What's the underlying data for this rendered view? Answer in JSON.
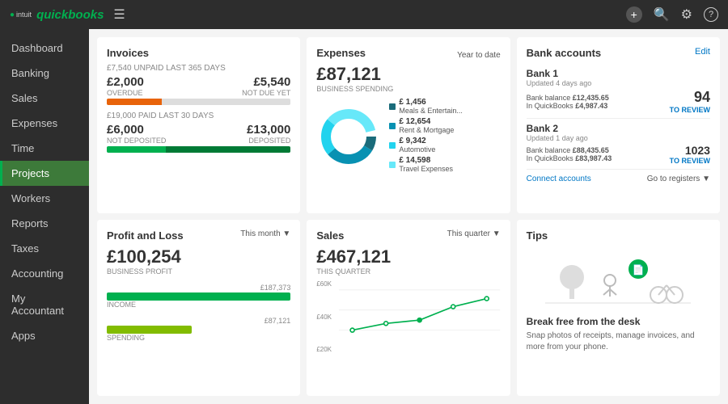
{
  "topnav": {
    "logo_text": "quickbooks",
    "intuit_text": "intuit",
    "add_label": "+",
    "search_label": "🔍",
    "settings_label": "⚙",
    "help_label": "?"
  },
  "sidebar": {
    "items": [
      {
        "label": "Dashboard",
        "active": false
      },
      {
        "label": "Banking",
        "active": false
      },
      {
        "label": "Sales",
        "active": false
      },
      {
        "label": "Expenses",
        "active": false
      },
      {
        "label": "Time",
        "active": false
      },
      {
        "label": "Projects",
        "active": true
      },
      {
        "label": "Workers",
        "active": false
      },
      {
        "label": "Reports",
        "active": false
      },
      {
        "label": "Taxes",
        "active": false
      },
      {
        "label": "Accounting",
        "active": false
      },
      {
        "label": "My Accountant",
        "active": false
      },
      {
        "label": "Apps",
        "active": false
      }
    ]
  },
  "invoices": {
    "title": "Invoices",
    "unpaid_label": "£7,540 UNPAID LAST 365 DAYS",
    "overdue_amount": "£2,000",
    "overdue_label": "OVERDUE",
    "not_due_amount": "£5,540",
    "not_due_label": "NOT DUE YET",
    "paid_label": "£19,000 PAID LAST 30 DAYS",
    "not_deposited_amount": "£6,000",
    "not_deposited_label": "NOT DEPOSITED",
    "deposited_amount": "£13,000",
    "deposited_label": "DEPOSITED"
  },
  "expenses": {
    "title": "Expenses",
    "period": "Year to date",
    "amount": "£87,121",
    "label": "BUSINESS SPENDING",
    "legend": [
      {
        "label": "Meals & Entertain...",
        "value": "£ 1,456",
        "color": "#1a6b7a",
        "pct": 8
      },
      {
        "label": "Rent & Mortgage",
        "value": "£ 12,654",
        "color": "#0891b2",
        "pct": 30
      },
      {
        "label": "Automotive",
        "value": "£ 9,342",
        "color": "#22d3ee",
        "pct": 22
      },
      {
        "label": "Travel Expenses",
        "value": "£ 14,598",
        "color": "#67e8f9",
        "pct": 35
      }
    ]
  },
  "bank_accounts": {
    "title": "Bank accounts",
    "edit_label": "Edit",
    "bank1": {
      "name": "Bank 1",
      "updated": "Updated 4 days ago",
      "balance_label": "Bank balance",
      "balance_val": "£12,435.65",
      "qb_label": "In QuickBooks",
      "qb_val": "£4,987.43",
      "review_num": "94",
      "review_label": "TO REVIEW"
    },
    "bank2": {
      "name": "Bank 2",
      "updated": "Updated 1 day ago",
      "balance_label": "Bank balance",
      "balance_val": "£88,435.65",
      "qb_label": "In QuickBooks",
      "qb_val": "£83,987.43",
      "review_num": "1023",
      "review_label": "TO REVIEW"
    },
    "connect_label": "Connect accounts",
    "registers_label": "Go to registers ▼"
  },
  "pnl": {
    "title": "Profit and Loss",
    "period": "This month ▼",
    "amount": "£100,254",
    "label": "BUSINESS PROFIT",
    "income_val": "£187,373",
    "income_label": "INCOME",
    "spending_val": "£87,121",
    "spending_label": "SPENDING"
  },
  "sales": {
    "title": "Sales",
    "period": "This quarter ▼",
    "amount": "£467,121",
    "label": "THIS QUARTER",
    "y_labels": [
      "£60K",
      "£40K",
      "£20K"
    ]
  },
  "tips": {
    "title": "Tips",
    "heading": "Break free from the desk",
    "text": "Snap photos of receipts, manage invoices, and more from your phone."
  }
}
